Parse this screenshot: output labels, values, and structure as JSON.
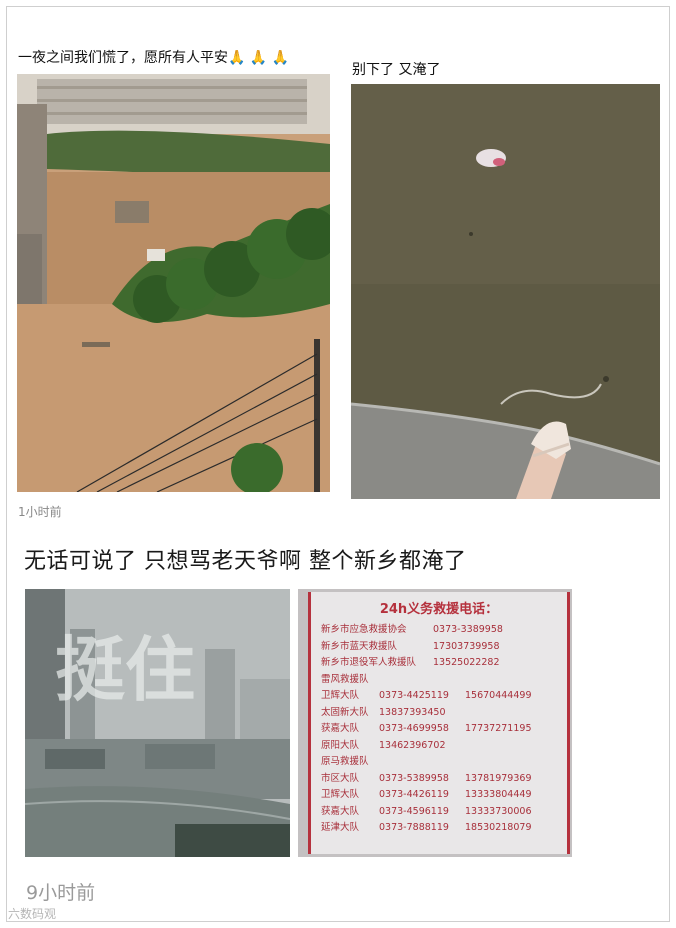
{
  "post1": {
    "caption_left": "一夜之间我们慌了，愿所有人平安🙏 🙏 🙏",
    "caption_right": "别下了  又淹了",
    "timestamp": "1小时前"
  },
  "post2": {
    "text": "无话可说了 只想骂老天爷啊 整个新乡都淹了",
    "overlay_text": "挺住",
    "timestamp": "9小时前"
  },
  "rescue_notice": {
    "title": "24h义务救援电话：",
    "top_rows": [
      {
        "name": "新乡市应急救援协会",
        "phone": "0373-3389958"
      },
      {
        "name": "新乡市蓝天救援队",
        "phone": "17303739958"
      },
      {
        "name": "新乡市退役军人救援队",
        "phone": "13525022282"
      }
    ],
    "section1": "雷风救援队",
    "section1_rows": [
      {
        "name": "卫辉大队",
        "phone1": "0373-4425119",
        "phone2": "15670444499"
      },
      {
        "name": "太固新大队",
        "phone1": "13837393450",
        "phone2": ""
      },
      {
        "name": "获嘉大队",
        "phone1": "0373-4699958",
        "phone2": "17737271195"
      },
      {
        "name": "原阳大队",
        "phone1": "13462396702",
        "phone2": ""
      }
    ],
    "section2": "原马救援队",
    "section2_rows": [
      {
        "name": "市区大队",
        "phone1": "0373-5389958",
        "phone2": "13781979369"
      },
      {
        "name": "卫辉大队",
        "phone1": "0373-4426119",
        "phone2": "13333804449"
      },
      {
        "name": "获嘉大队",
        "phone1": "0373-4596119",
        "phone2": "13333730006"
      },
      {
        "name": "延津大队",
        "phone1": "0373-7888119",
        "phone2": "18530218079"
      }
    ]
  },
  "watermark": "六数码观"
}
